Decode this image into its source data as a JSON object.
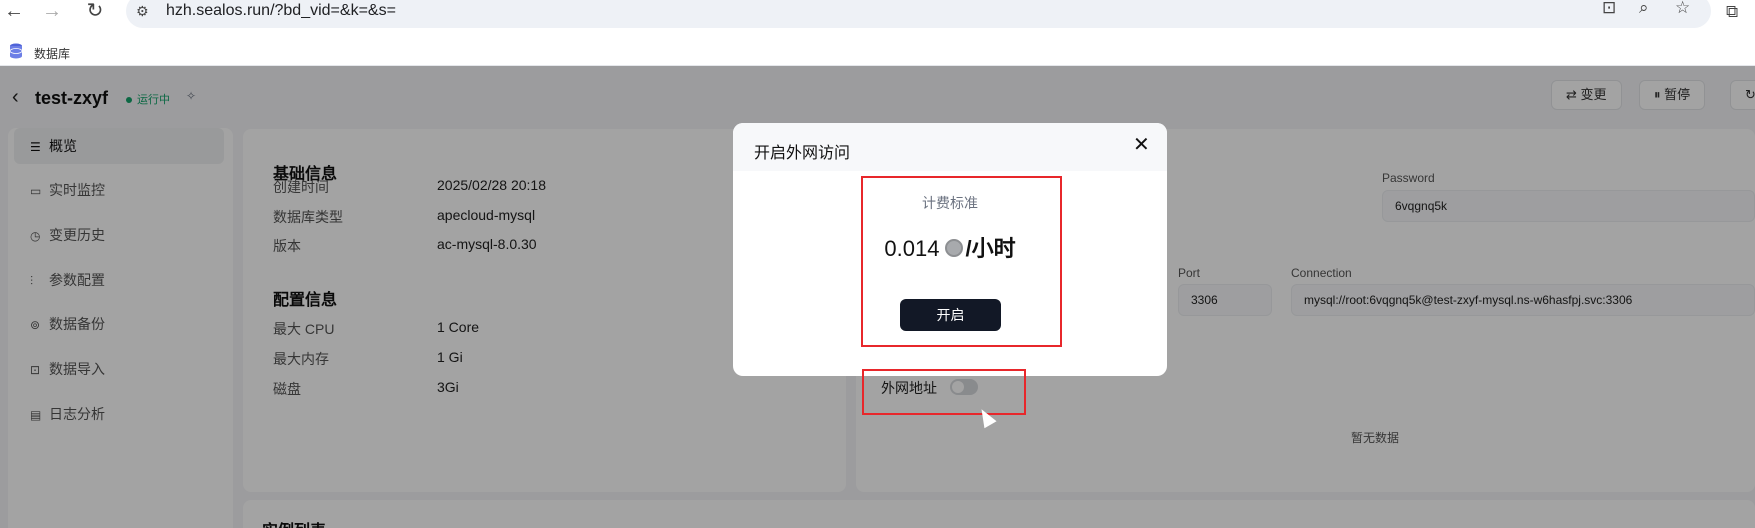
{
  "browser": {
    "url": "hzh.sealos.run/?bd_vid=&k=&s=",
    "bookmark_label": "数据库"
  },
  "header": {
    "app_name": "test-zxyf",
    "status": "运行中",
    "change_button": "变更",
    "pause_button": "暂停"
  },
  "sidebar": {
    "items": [
      {
        "label": "概览",
        "icon": "list-icon"
      },
      {
        "label": "实时监控",
        "icon": "monitor-icon"
      },
      {
        "label": "变更历史",
        "icon": "history-icon"
      },
      {
        "label": "参数配置",
        "icon": "sliders-icon"
      },
      {
        "label": "数据备份",
        "icon": "backup-icon"
      },
      {
        "label": "数据导入",
        "icon": "import-icon"
      },
      {
        "label": "日志分析",
        "icon": "log-icon"
      }
    ]
  },
  "basic_info": {
    "title": "基础信息",
    "rows": [
      {
        "label": "创建时间",
        "value": "2025/02/28 20:18"
      },
      {
        "label": "数据库类型",
        "value": "apecloud-mysql"
      },
      {
        "label": "版本",
        "value": "ac-mysql-8.0.30"
      }
    ]
  },
  "config_info": {
    "title": "配置信息",
    "rows": [
      {
        "label": "最大 CPU",
        "value": "1 Core"
      },
      {
        "label": "最大内存",
        "value": "1 Gi"
      },
      {
        "label": "磁盘",
        "value": "3Gi"
      }
    ]
  },
  "connection": {
    "password_label": "Password",
    "password_value": "6vqgnq5k",
    "port_label": "Port",
    "port_value": "3306",
    "connection_label": "Connection",
    "connection_value": "mysql://root:6vqgnq5k@test-zxyf-mysql.ns-w6hasfpj.svc:3306",
    "external_label": "外网地址",
    "no_data": "暂无数据"
  },
  "instance_title": "实例列表",
  "modal": {
    "title": "开启外网访问",
    "billing_label": "计费标准",
    "price": "0.014",
    "unit": "/小时",
    "open_button": "开启"
  },
  "colors": {
    "accent_dark": "#121826",
    "status_green": "#13a36b",
    "highlight_red": "#e8272b"
  }
}
